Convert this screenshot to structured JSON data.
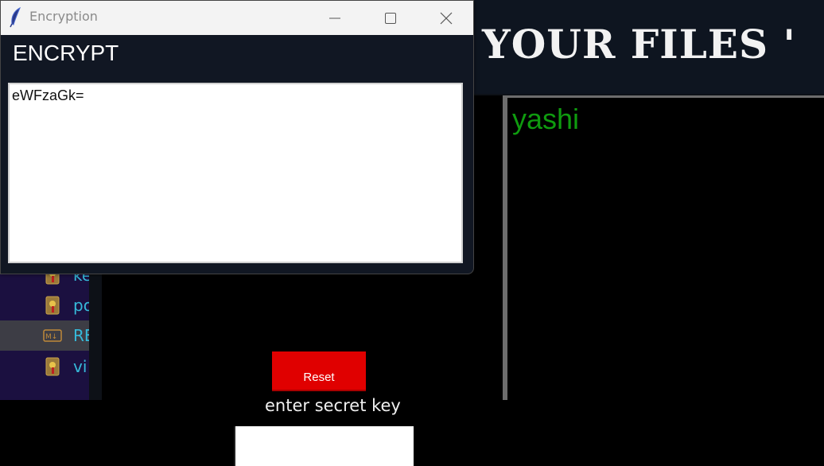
{
  "encryption_window": {
    "title": "Encryption",
    "heading": "ENCRYPT",
    "encrypted_text": "eWFzaGk="
  },
  "main_app": {
    "title_visible": "YOUR FILES '",
    "reset_label": "Reset",
    "secret_key_label": "enter secret key",
    "secret_key_value": "",
    "output_text": "yashi"
  },
  "sidebar": {
    "files": [
      {
        "name": "ke",
        "icon": "key-file-icon"
      },
      {
        "name": "po",
        "icon": "key-file-icon"
      },
      {
        "name": "RE",
        "icon": "markdown-file-icon"
      },
      {
        "name": "vi",
        "icon": "key-file-icon"
      }
    ]
  },
  "colors": {
    "reset_button": "#e00000",
    "output_text": "#0f9b0f",
    "sidebar_text": "#36b9d9",
    "sidebar_bg": "#1b1040"
  }
}
